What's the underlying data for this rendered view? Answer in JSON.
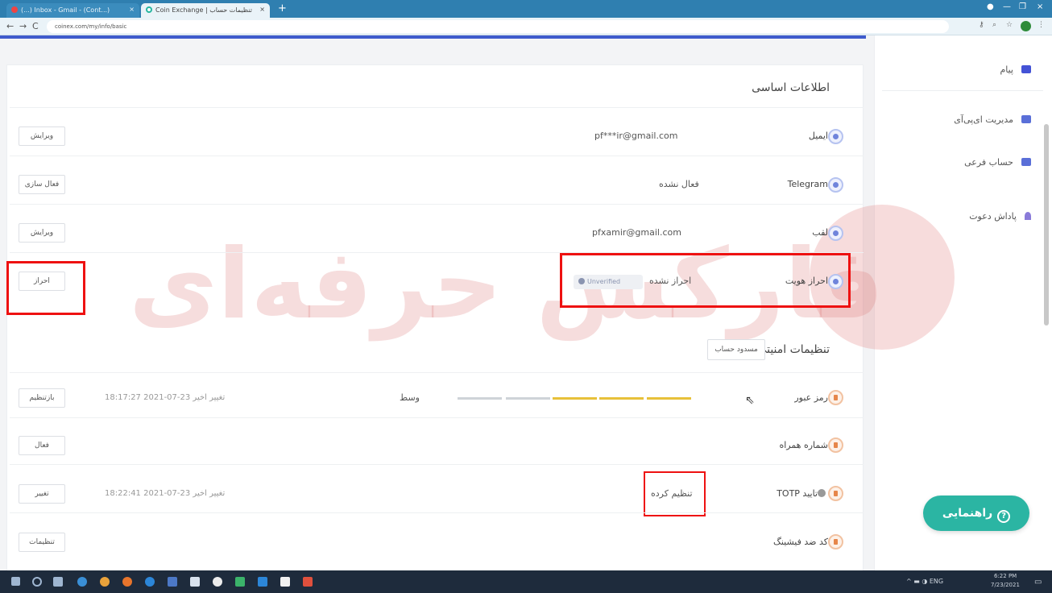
{
  "browser": {
    "tab1_title": "(...) Inbox - Gmail - (Cont...)",
    "tab2_title": "Coin Exchange | تنظیمات حساب",
    "url": "coinex.com/my/info/basic",
    "tab_close": "×",
    "new_tab": "+",
    "back": "←",
    "forward": "→",
    "reload": "C",
    "min": "—",
    "max": "❐",
    "close": "×"
  },
  "sidebar": {
    "items": [
      {
        "label": "پیام"
      },
      {
        "label": "مدیریت ای‌پی‌آی"
      },
      {
        "label": "حساب فرعی"
      },
      {
        "label": "پاداش دعوت"
      }
    ],
    "colors": [
      "#4453d6",
      "#5a6fd8",
      "#5a6fd8",
      "#8a7bd9"
    ]
  },
  "basic": {
    "title": "اطلاعات اساسی",
    "rows": [
      {
        "label": "ایمیل",
        "value": "pf***ir@gmail.com",
        "button": "ویرایش"
      },
      {
        "label": "Telegram",
        "value": "فعال نشده",
        "button": "فعال سازی"
      },
      {
        "label": "لقب",
        "value": "pfxamir@gmail.com",
        "button": "ویرایش"
      },
      {
        "label": "احراز هویت",
        "value": "احراز نشده",
        "badge": "Unverified",
        "button": "احراز"
      }
    ]
  },
  "security": {
    "title": "تنظیمات امنیتی",
    "freeze_button": "مسدود حساب",
    "rows": [
      {
        "label": "رمز عبور",
        "value": "وسط",
        "timestamp": "تغییر اخیر 23-07-2021 18:17:27",
        "button": "بازتنظیم"
      },
      {
        "label": "شماره همراه",
        "button": "فعال"
      },
      {
        "label": "تایید TOTP",
        "value": "تنظیم کرده",
        "timestamp": "تغییر اخیر 23-07-2021 18:22:41",
        "button": "تغییر"
      },
      {
        "label": "کد ضد فیشینگ",
        "button": "تنظیمات"
      }
    ]
  },
  "strength_colors": [
    "#cfd3d8",
    "#cfd3d8",
    "#e8c13a",
    "#e8c13a",
    "#e8c13a"
  ],
  "help_button": "راهنمایی",
  "watermark": "فارکس حرفه‌ای",
  "taskbar": {
    "tray_text": "^ ▬ ◑ ENG",
    "time": "6:22 PM",
    "date": "7/23/2021"
  }
}
